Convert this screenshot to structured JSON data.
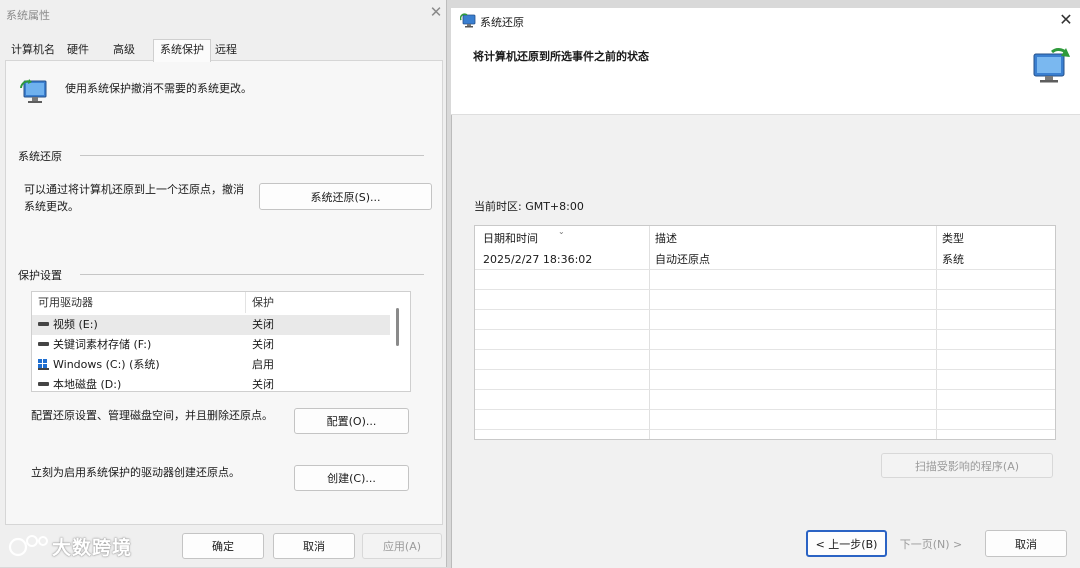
{
  "sysprops": {
    "title": "系统属性",
    "tabs": [
      "计算机名",
      "硬件",
      "高级",
      "系统保护",
      "远程"
    ],
    "active_tab": "系统保护",
    "intro": "使用系统保护撤消不需要的系统更改。",
    "restore_section": {
      "label": "系统还原",
      "desc_line1": "可以通过将计算机还原到上一个还原点，撤消",
      "desc_line2": "系统更改。",
      "button": "系统还原(S)..."
    },
    "protection_section": {
      "label": "保护设置",
      "columns": [
        "可用驱动器",
        "保护"
      ],
      "drives": [
        {
          "name": "视频 (E:)",
          "status": "关闭",
          "icon": "drive-icon"
        },
        {
          "name": "关键词素材存储 (F:)",
          "status": "关闭",
          "icon": "drive-icon"
        },
        {
          "name": "Windows (C:) (系统)",
          "status": "启用",
          "icon": "windows-drive-icon"
        },
        {
          "name": "本地磁盘 (D:)",
          "status": "关闭",
          "icon": "drive-icon"
        }
      ],
      "configure_text": "配置还原设置、管理磁盘空间，并且删除还原点。",
      "configure_button": "配置(O)...",
      "create_text": "立刻为启用系统保护的驱动器创建还原点。",
      "create_button": "创建(C)..."
    },
    "footer": {
      "ok": "确定",
      "cancel": "取消",
      "apply": "应用(A)"
    }
  },
  "restore": {
    "title": "系统还原",
    "heading": "将计算机还原到所选事件之前的状态",
    "timezone": "当前时区: GMT+8:00",
    "columns": [
      "日期和时间",
      "描述",
      "类型"
    ],
    "points": [
      {
        "datetime": "2025/2/27 18:36:02",
        "description": "自动还原点",
        "type": "系统"
      }
    ],
    "scan_button": "扫描受影响的程序(A)",
    "back_button": "< 上一步(B)",
    "next_button": "下一页(N) >",
    "cancel_button": "取消"
  },
  "watermark": "大数跨境",
  "colors": {
    "accent": "#2b63c4",
    "window_bg": "#efefef",
    "panel_bg": "#f7f7f7"
  }
}
